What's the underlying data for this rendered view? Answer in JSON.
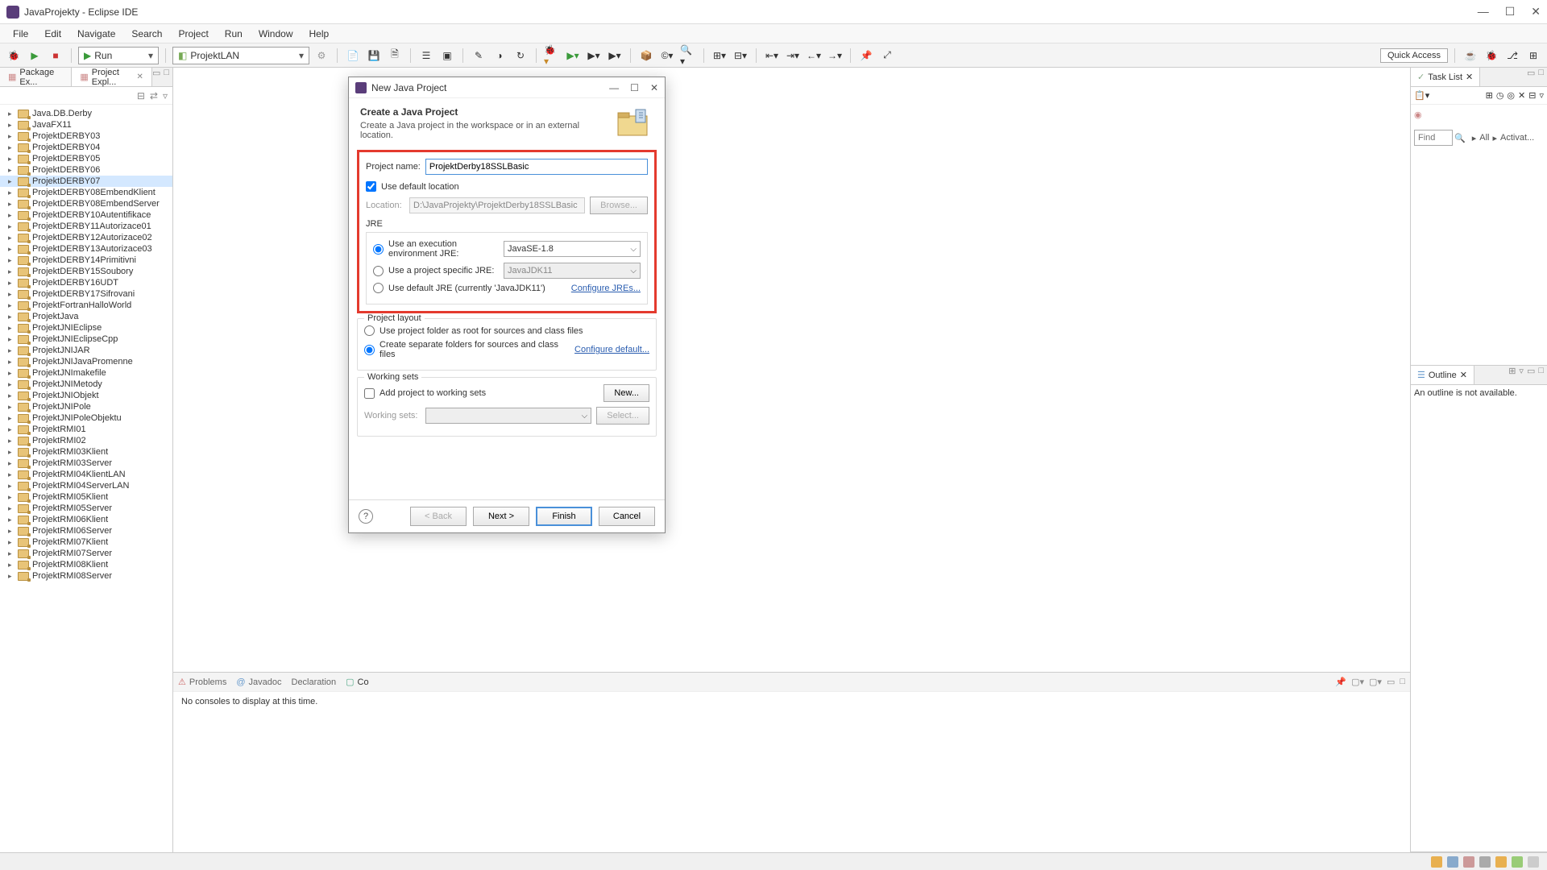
{
  "window": {
    "title": "JavaProjekty - Eclipse IDE"
  },
  "menu": [
    "File",
    "Edit",
    "Navigate",
    "Search",
    "Project",
    "Run",
    "Window",
    "Help"
  ],
  "toolbar": {
    "run_label": "Run",
    "launch_label": "ProjektLAN",
    "quick_access": "Quick Access"
  },
  "left": {
    "tabs": [
      {
        "label": "Package Ex..."
      },
      {
        "label": "Project Expl...",
        "active": true
      }
    ],
    "projects": [
      "Java.DB.Derby",
      "JavaFX11",
      "ProjektDERBY03",
      "ProjektDERBY04",
      "ProjektDERBY05",
      "ProjektDERBY06",
      "ProjektDERBY07",
      "ProjektDERBY08EmbendKlient",
      "ProjektDERBY08EmbendServer",
      "ProjektDERBY10Autentifikace",
      "ProjektDERBY11Autorizace01",
      "ProjektDERBY12Autorizace02",
      "ProjektDERBY13Autorizace03",
      "ProjektDERBY14Primitivni",
      "ProjektDERBY15Soubory",
      "ProjektDERBY16UDT",
      "ProjektDERBY17Sifrovani",
      "ProjektFortranHalloWorld",
      "ProjektJava",
      "ProjektJNIEclipse",
      "ProjektJNIEclipseCpp",
      "ProjektJNIJAR",
      "ProjektJNIJavaPromenne",
      "ProjektJNImakefile",
      "ProjektJNIMetody",
      "ProjektJNIObjekt",
      "ProjektJNIPole",
      "ProjektJNIPoleObjektu",
      "ProjektRMI01",
      "ProjektRMI02",
      "ProjektRMI03Klient",
      "ProjektRMI03Server",
      "ProjektRMI04KlientLAN",
      "ProjektRMI04ServerLAN",
      "ProjektRMI05Klient",
      "ProjektRMI05Server",
      "ProjektRMI06Klient",
      "ProjektRMI06Server",
      "ProjektRMI07Klient",
      "ProjektRMI07Server",
      "ProjektRMI08Klient",
      "ProjektRMI08Server"
    ],
    "selected_index": 6
  },
  "bottom": {
    "tabs": [
      "Problems",
      "Javadoc",
      "Declaration",
      "Co"
    ],
    "console_msg": "No consoles to display at this time."
  },
  "right": {
    "tasklist_label": "Task List",
    "find_label": "Find",
    "filters": [
      "All",
      "Activat..."
    ],
    "outline_label": "Outline",
    "outline_msg": "An outline is not available."
  },
  "dialog": {
    "title": "New Java Project",
    "heading": "Create a Java Project",
    "subheading": "Create a Java project in the workspace or in an external location.",
    "project_name_label": "Project name:",
    "project_name_value": "ProjektDerby18SSLBasic",
    "use_default_location": "Use default location",
    "location_label": "Location:",
    "location_value": "D:\\JavaProjekty\\ProjektDerby18SSLBasic",
    "browse": "Browse...",
    "jre_label": "JRE",
    "jre_exec_env": "Use an execution environment JRE:",
    "jre_exec_env_value": "JavaSE-1.8",
    "jre_project_specific": "Use a project specific JRE:",
    "jre_project_value": "JavaJDK11",
    "jre_default": "Use default JRE (currently 'JavaJDK11')",
    "configure_jres": "Configure JREs...",
    "layout_label": "Project layout",
    "layout_root": "Use project folder as root for sources and class files",
    "layout_separate": "Create separate folders for sources and class files",
    "configure_default": "Configure default...",
    "working_sets_label": "Working sets",
    "add_to_ws": "Add project to working sets",
    "new_btn": "New...",
    "ws_label": "Working sets:",
    "select_btn": "Select...",
    "back": "< Back",
    "next": "Next >",
    "finish": "Finish",
    "cancel": "Cancel"
  }
}
